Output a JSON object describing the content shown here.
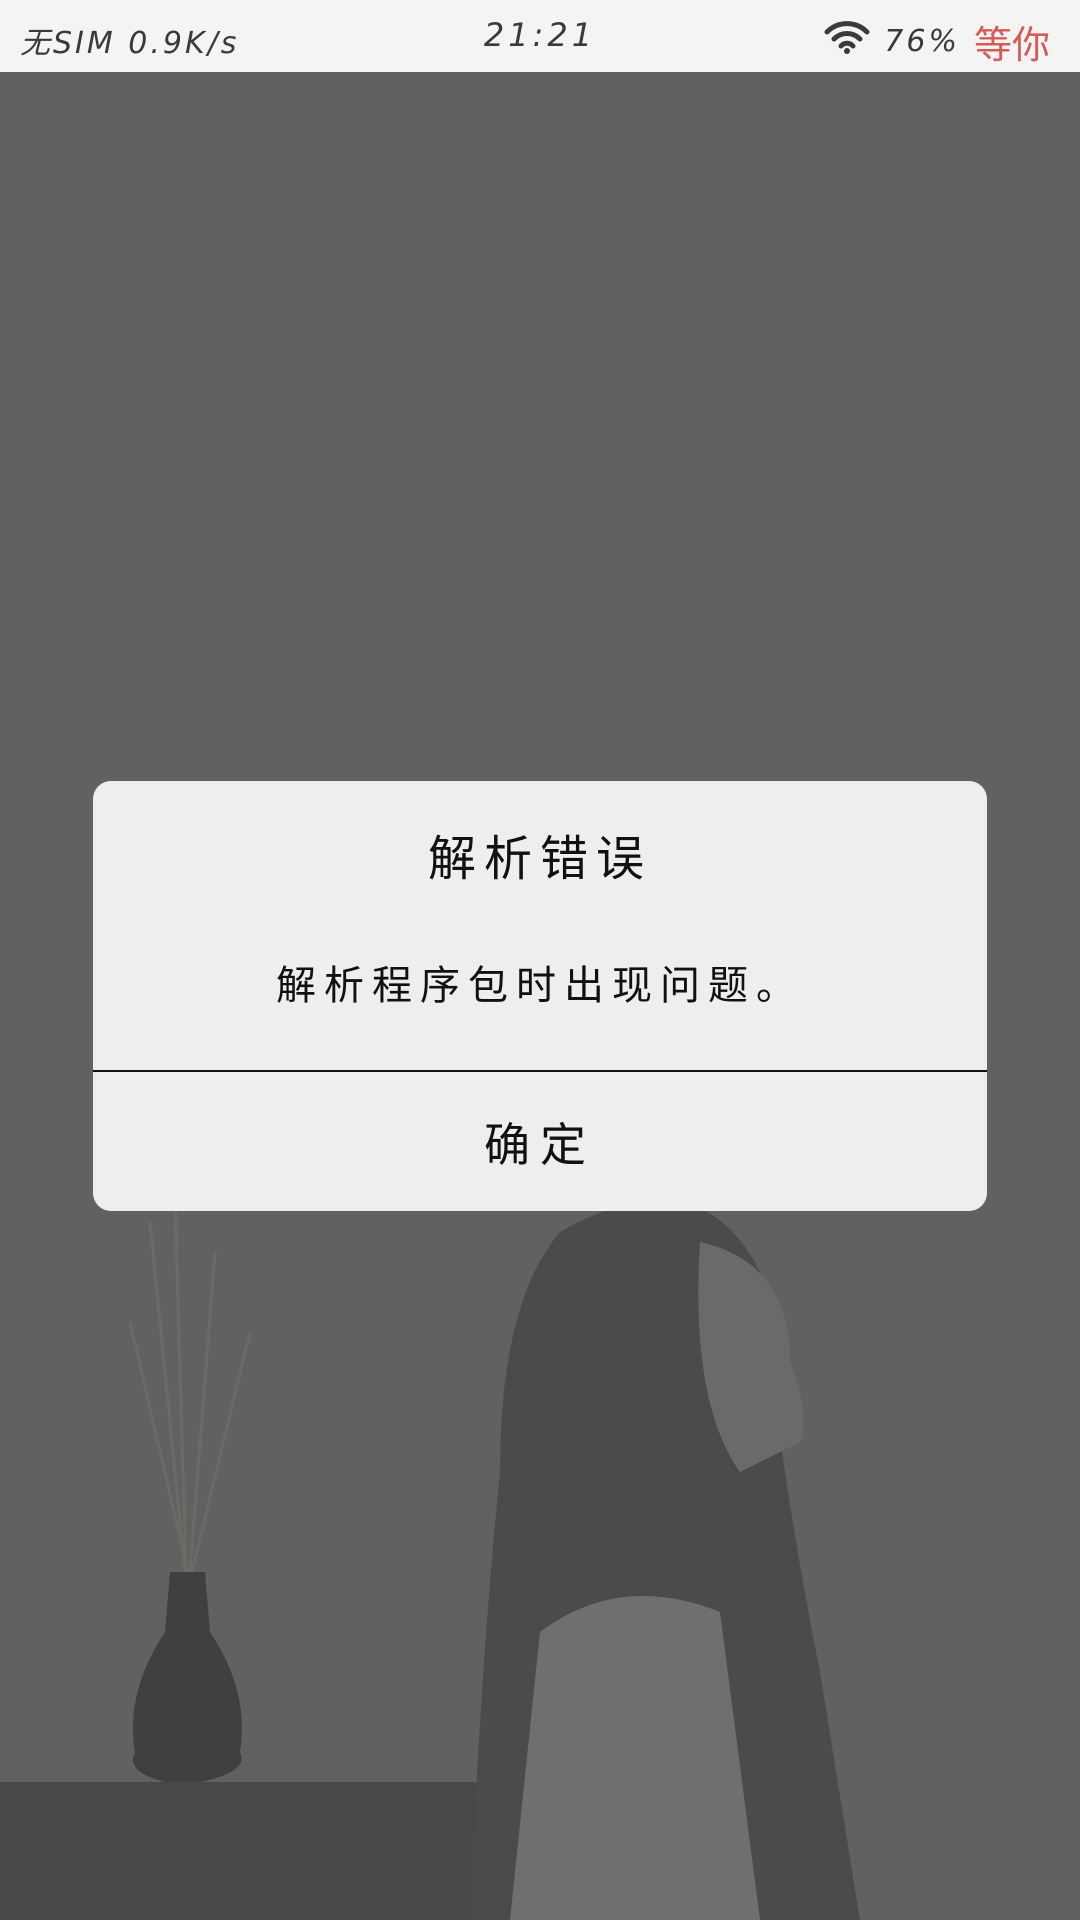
{
  "status_bar": {
    "left_text": "无SIM 0.9K/s",
    "time": "21:21",
    "battery": "76%",
    "extra": "等你"
  },
  "dialog": {
    "title": "解析错误",
    "message": "解析程序包时出现问题。",
    "ok_label": "确定"
  },
  "colors": {
    "background": "#5f6160",
    "dialog_bg": "#eeeeee",
    "status_bar_bg": "#f3f4f3",
    "accent_red": "#d65b57"
  }
}
